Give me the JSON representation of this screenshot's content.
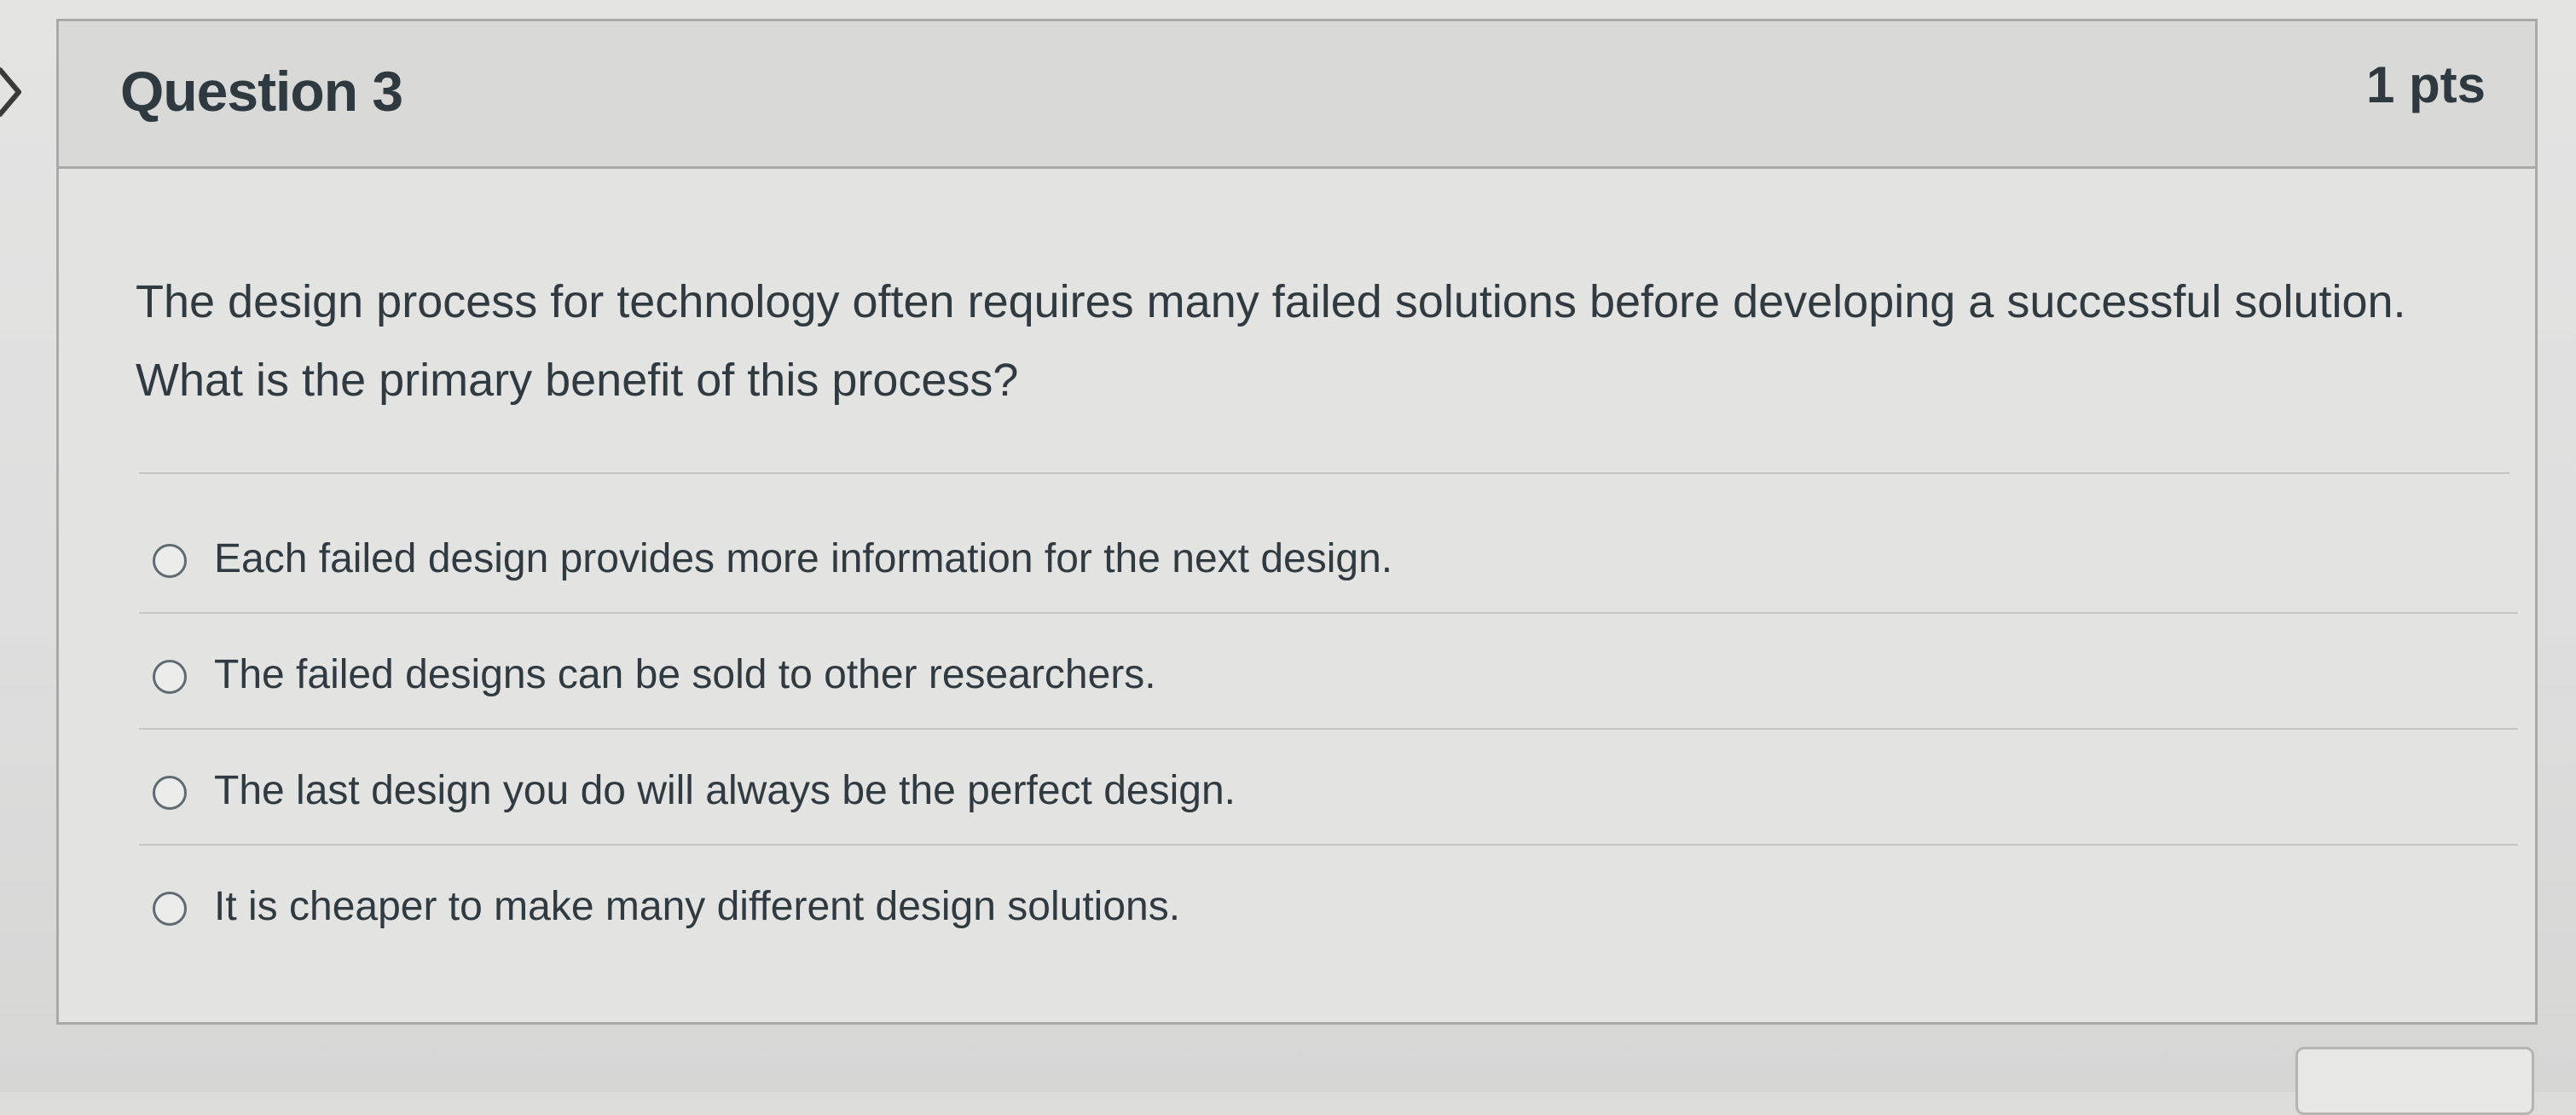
{
  "question": {
    "title": "Question 3",
    "points": "1 pts",
    "text": "The design process for technology often requires many failed solutions before developing a successful solution. What is the primary benefit of this process?",
    "answers": [
      {
        "label": "Each failed design provides more information for the next design.",
        "selected": false
      },
      {
        "label": "The failed designs can be sold to other researchers.",
        "selected": false
      },
      {
        "label": "The last design you do will always be the perfect design.",
        "selected": false
      },
      {
        "label": "It is cheaper to make many different design solutions.",
        "selected": false
      }
    ]
  },
  "icons": {
    "previous_arrow": "chevron-right-icon",
    "radio": "radio-unchecked-icon"
  }
}
